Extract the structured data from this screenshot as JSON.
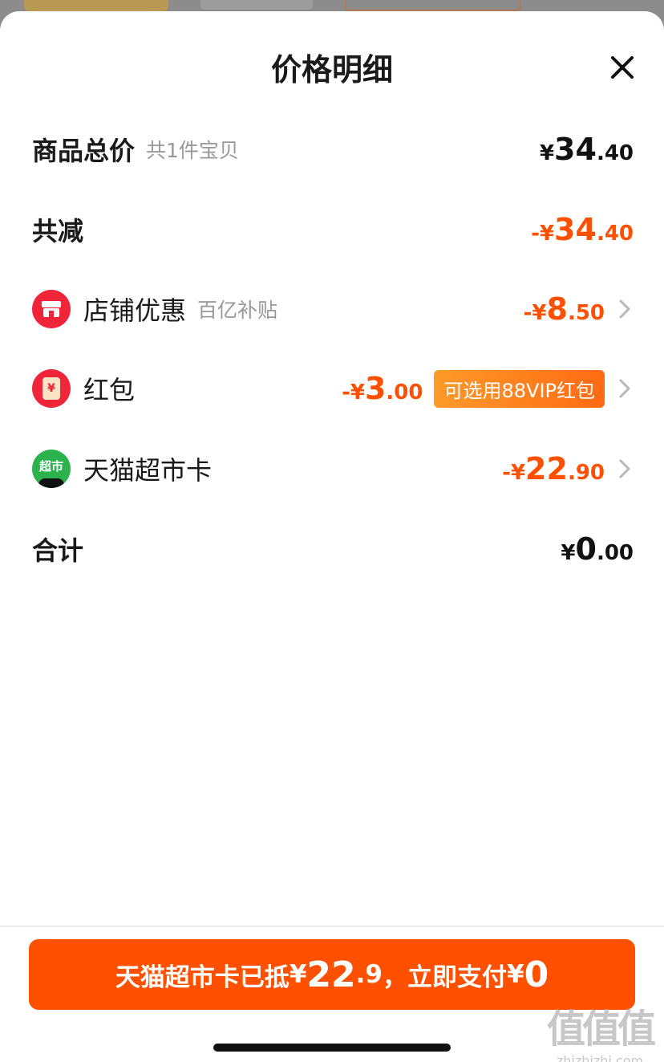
{
  "sheet": {
    "title": "价格明细"
  },
  "rows": {
    "total": {
      "label": "商品总价",
      "sub": "共1件宝贝",
      "currency": "¥",
      "int": "34",
      "dec": ".40"
    },
    "discount": {
      "label": "共减",
      "currency": "-¥",
      "int": "34",
      "dec": ".40"
    },
    "store": {
      "label": "店铺优惠",
      "sub": "百亿补贴",
      "currency": "-¥",
      "int": "8",
      "dec": ".50",
      "icon": "store-icon"
    },
    "redpacket": {
      "label": "红包",
      "currency": "-¥",
      "int": "3",
      "dec": ".00",
      "badge": "可选用88VIP红包",
      "icon": "red-packet-icon",
      "icon_text": "¥"
    },
    "card": {
      "label": "天猫超市卡",
      "currency": "-¥",
      "int": "22",
      "dec": ".90",
      "icon": "tmall-supermarket-icon",
      "icon_text": "超市"
    },
    "sum": {
      "label": "合计",
      "currency": "¥",
      "int": "0",
      "dec": ".00"
    }
  },
  "pay_button": {
    "prefix": "天猫超市卡已抵",
    "cur1": "¥",
    "amount_int": "22",
    "amount_dec": ".9",
    "middle": "，立即支付",
    "cur2": "¥",
    "pay_amount": "0"
  },
  "watermark": {
    "big": "值值值",
    "small": "zhizhizhi.com"
  },
  "colors": {
    "accent": "#ff5000",
    "badge_start": "#ff9a2a",
    "badge_end": "#ff6a13",
    "store_icon": "#f0253a",
    "red_packet_icon": "#f0253a",
    "supermarket_icon": "#2bb24c"
  }
}
